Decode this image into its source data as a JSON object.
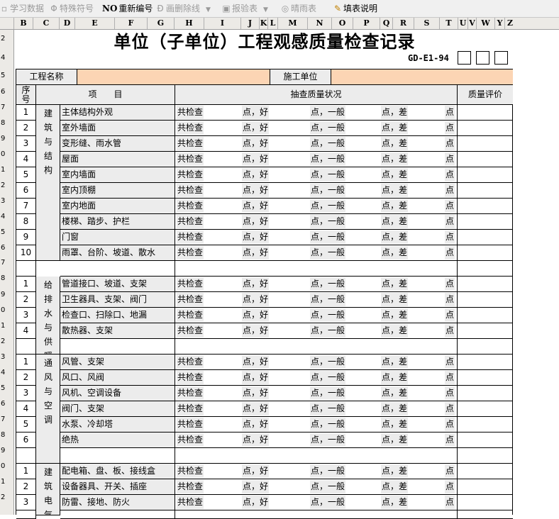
{
  "toolbar": {
    "items": [
      {
        "label": "学习数据",
        "icon": "study-icon",
        "enabled": false
      },
      {
        "label": "特殊符号",
        "icon": "special-symbol-icon",
        "enabled": false
      },
      {
        "label": "重新编号",
        "icon": "renumber-icon",
        "icon_text": "NO",
        "enabled": true
      },
      {
        "label": "画删除线",
        "icon": "strikethrough-icon",
        "enabled": false
      },
      {
        "label": "报验表",
        "icon": "inspection-form-icon",
        "enabled": false
      },
      {
        "label": "晴雨表",
        "icon": "weather-icon",
        "enabled": false
      },
      {
        "label": "填表说明",
        "icon": "form-help-icon",
        "enabled": true
      }
    ]
  },
  "columns": [
    "B",
    "C",
    "D",
    "E",
    "F",
    "G",
    "H",
    "I",
    "J",
    "K",
    "L",
    "M",
    "N",
    "O",
    "P",
    "Q",
    "R",
    "S",
    "T",
    "U",
    "V",
    "W",
    "Y",
    "Z"
  ],
  "row_numbers": [
    "2",
    "4",
    "5",
    "6",
    "7",
    "8",
    "9",
    "0",
    "1",
    "2",
    "3",
    "4",
    "5",
    "6",
    "7",
    "8",
    "9",
    "0",
    "1",
    "2",
    "3",
    "4",
    "5",
    "6",
    "7",
    "8",
    "9",
    "0",
    "1",
    "2"
  ],
  "form": {
    "title": "单位（子单位）工程观感质量检查记录",
    "code": "GD-E1-94",
    "project_name_label": "工程名称",
    "project_name_value": "",
    "construction_unit_label": "施工单位",
    "construction_unit_value": "",
    "headers": {
      "seq": "序号",
      "item": "项　　目",
      "status": "抽查质量状况",
      "evaluation": "质量评价"
    },
    "check_text": {
      "total": "共检查",
      "good": "点，好",
      "ok": "点，一般",
      "bad": "点，差",
      "end": "点"
    },
    "groups": [
      {
        "category": "建筑与结构",
        "items": [
          {
            "no": "1",
            "name": "主体结构外观"
          },
          {
            "no": "2",
            "name": "室外墙面"
          },
          {
            "no": "3",
            "name": "变形缝、雨水管"
          },
          {
            "no": "4",
            "name": "屋面"
          },
          {
            "no": "5",
            "name": "室内墙面"
          },
          {
            "no": "6",
            "name": "室内顶棚"
          },
          {
            "no": "7",
            "name": "室内地面"
          },
          {
            "no": "8",
            "name": "楼梯、踏步、护栏"
          },
          {
            "no": "9",
            "name": "门窗"
          },
          {
            "no": "10",
            "name": "雨罩、台阶、坡道、散水"
          }
        ]
      },
      {
        "category": "给排水与供暖",
        "items": [
          {
            "no": "1",
            "name": "管道接口、坡道、支架"
          },
          {
            "no": "2",
            "name": "卫生器具、支架、阀门"
          },
          {
            "no": "3",
            "name": "检查口、扫除口、地漏"
          },
          {
            "no": "4",
            "name": "散热器、支架"
          }
        ]
      },
      {
        "category": "通风与空调",
        "items": [
          {
            "no": "1",
            "name": "风管、支架"
          },
          {
            "no": "2",
            "name": "风口、风阀"
          },
          {
            "no": "3",
            "name": "风机、空调设备"
          },
          {
            "no": "4",
            "name": "阀门、支架"
          },
          {
            "no": "5",
            "name": "水泵、冷却塔"
          },
          {
            "no": "6",
            "name": "绝热"
          }
        ]
      },
      {
        "category": "建筑电气",
        "items": [
          {
            "no": "1",
            "name": "配电箱、盘、板、接线盒"
          },
          {
            "no": "2",
            "name": "设备器具、开关、插座"
          },
          {
            "no": "3",
            "name": "防雷、接地、防火"
          }
        ]
      }
    ]
  },
  "colors": {
    "input_fill": "#fcd5b4",
    "label_fill": "#ececec",
    "header_bg": "#eceae6"
  }
}
